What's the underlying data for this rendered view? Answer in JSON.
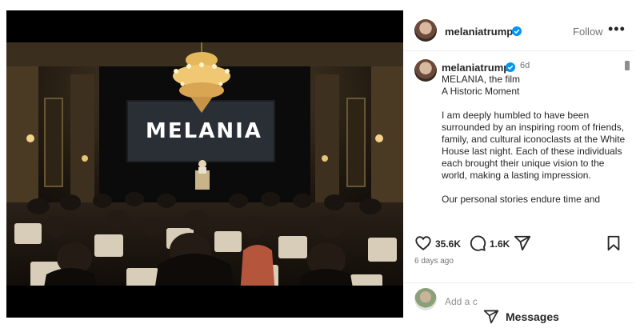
{
  "post": {
    "username": "melaniatrump",
    "follow_label": "Follow",
    "more_label": "•••",
    "time": "6d",
    "ago": "6 days ago"
  },
  "media": {
    "screen_text": "MELANIA"
  },
  "caption": {
    "username": "melaniatrump",
    "line1": "MELANIA, the film",
    "line2": "A Historic Moment",
    "paragraph1": "I am deeply humbled to have been surrounded by an inspiring room of friends, family, and cultural iconoclasts at the White House last night.  Each of these individuals each brought their unique vision to the world, making a lasting impression.",
    "paragraph2": "Our personal stories endure time and"
  },
  "stats": {
    "likes": "35.6K",
    "comments": "1.6K"
  },
  "comment_box": {
    "placeholder": "Add a c"
  },
  "messages": {
    "label": "Messages"
  },
  "colors": {
    "verified": "#0095f6",
    "muted": "#737373"
  }
}
